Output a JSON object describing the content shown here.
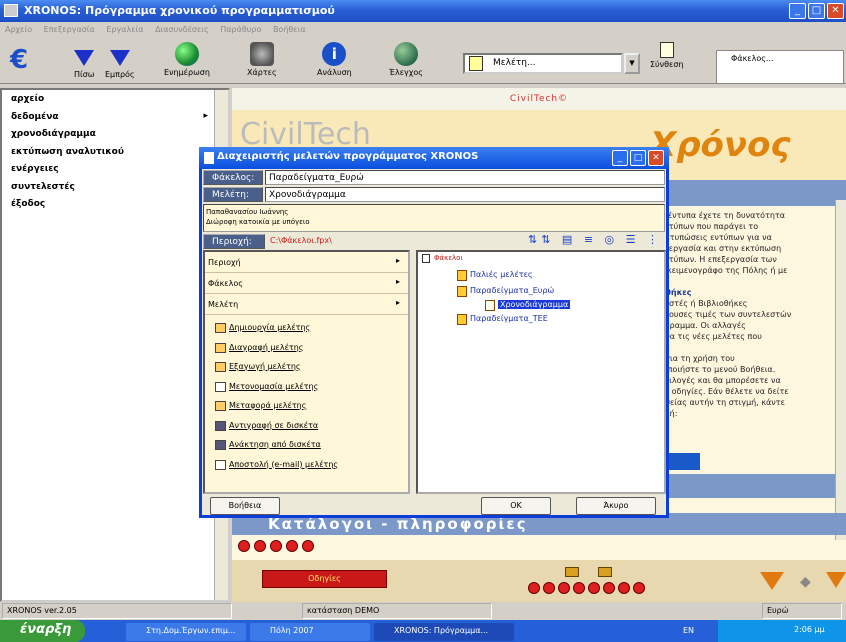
{
  "window": {
    "title": "XRONOS: Πρόγραμμα χρονικού προγραμματισμού",
    "controls": [
      "_",
      "□",
      "✕"
    ]
  },
  "menubar": [
    "Αρχείο",
    "Επεξεργασία",
    "Εργαλεία",
    "Διασυνδέσεις",
    "Παράθυρο",
    "Βοήθεια"
  ],
  "toolbar": {
    "back": "Πίσω",
    "forward": "Εμπρός",
    "update": "Ενημέρωση",
    "charts": "Χάρτες",
    "analysis": "Ανάλυση",
    "check": "Έλεγχος",
    "combo_value": "Μελέτη...",
    "synthesis": "Σύνθεση",
    "right_label": "Φάκελος..."
  },
  "sidebar": {
    "items": [
      {
        "label": "αρχείο"
      },
      {
        "label": "δεδομένα"
      },
      {
        "label": "χρονοδιάγραμμα"
      },
      {
        "label": "εκτύπωση αναλυτικού"
      },
      {
        "label": "ενέργειες"
      },
      {
        "label": "συντελεστές"
      },
      {
        "label": "έξοδος"
      }
    ]
  },
  "content": {
    "header": "CivilTech©",
    "logo_left": "CivilTech",
    "logo_right": "Χρόνος",
    "text_block": [
      "ά έντυπα έχετε τη δυνατότητα",
      "εντύπων που παράγει το",
      "Εκτυπώσεις εντύπων για να",
      "εξεργασία και στην εκτύπωση",
      "εντύπων. Η επεξεργασία των",
      "ν κειμενογράφο της Πόλης ή με",
      "",
      "υθήκες",
      "λεστές ή Βιβλιοθήκες",
      "έχουσες τιμές των συντελεστών",
      "όγραμμα. Οι αλλαγές",
      "ανα τις νέες μελέτες που",
      "",
      "ι για τη χρήση του",
      "ιοποιήστε το μενού Βοήθεια.",
      "επιλογές και θα μπορέσετε να",
      "ες οδηγίες. Εάν θέλετε να δείτε",
      "ηθείας αυτήν τη στιγμή, κάντε",
      "ολή:"
    ],
    "katalogoi": "Κατάλογοι - πληροφορίες",
    "odigies": "Οδηγίες"
  },
  "dialog": {
    "title": "Διαχειριστής μελετών προγράμματος XRONOS",
    "folder_label": "Φάκελος:",
    "folder_value": "Παραδείγματα_Ευρώ",
    "study_label": "Μελέτη:",
    "study_value": "Χρονοδιάγραμμα",
    "desc_line1": "Παπαθανασίου Ιωάννης",
    "desc_line2": "Διώροφη κατοικία με υπόγειο",
    "area_label": "Περιοχή:",
    "area_value": "C:\\Φάκελοι.fpx\\",
    "menu_rows": [
      {
        "label": "Περιοχή"
      },
      {
        "label": "Φάκελος"
      },
      {
        "label": "Μελέτη"
      }
    ],
    "actions": [
      {
        "label": "Δημιουργία μελέτης"
      },
      {
        "label": "Διαγραφή μελέτης"
      },
      {
        "label": "Εξαγωγή μελέτης"
      },
      {
        "label": "Μετονομασία μελέτης"
      },
      {
        "label": "Μεταφορά μελέτης"
      },
      {
        "label": "Αντιγραφή σε δισκέτα"
      },
      {
        "label": "Ανάκτηση από δισκέτα"
      },
      {
        "label": "Αποστολή (e-mail) μελέτης"
      }
    ],
    "tree": {
      "root": "Φάκελοι",
      "nodes": [
        "Παλιές μελέτες",
        "Παραδείγματα_Ευρώ",
        "Χρονοδιάγραμμα",
        "Παραδείγματα_ΤΕΕ"
      ]
    },
    "help_button": "Βοήθεια",
    "ok_button": "OK",
    "cancel_button": "Άκυρο"
  },
  "statusbar": {
    "version": "XRONOS ver.2.05",
    "mode": "κατάσταση DEMO",
    "currency": "Ευρώ"
  },
  "taskbar": {
    "start": "έναρξη",
    "tasks": [
      "Στη.Δομ.Έργων.επιμ...",
      "Πόλη 2007",
      "XRONOS: Πρόγραμμα..."
    ],
    "lang": "EN",
    "clock": "2:06 μμ"
  },
  "colors": {
    "titlebar": "#2a5fd6",
    "dialog_border": "#0a3ed8",
    "accent_orange": "#e08410",
    "red_button": "#c81818"
  }
}
